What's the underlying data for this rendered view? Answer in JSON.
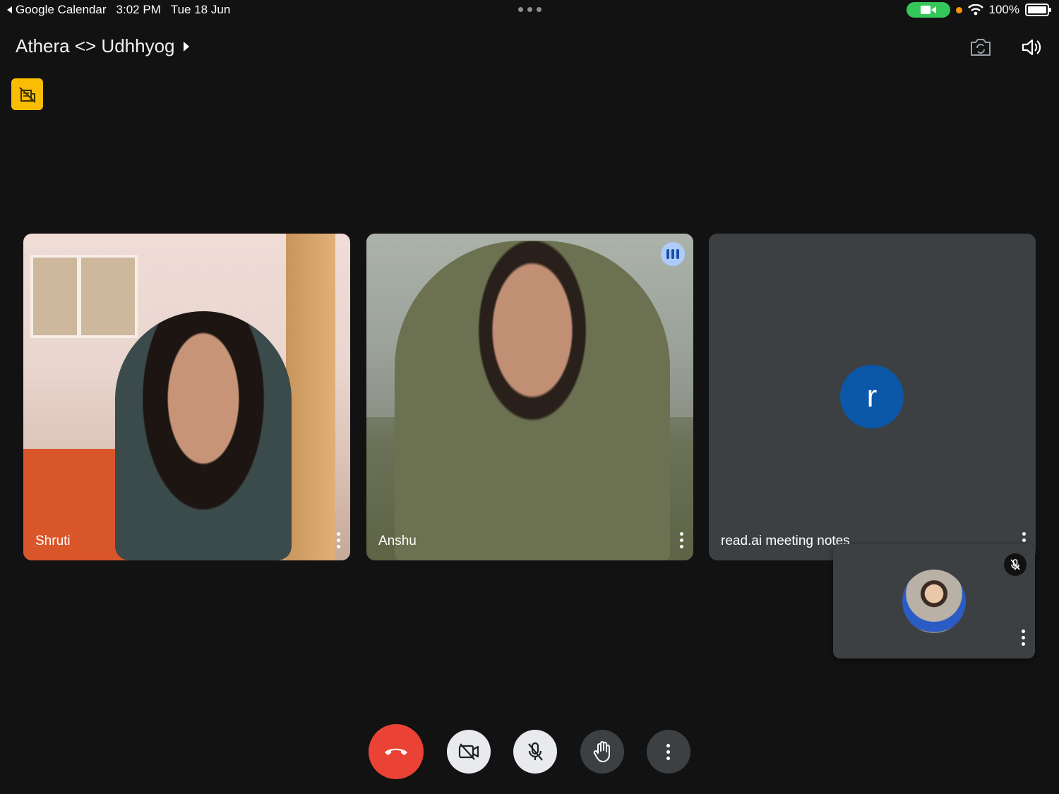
{
  "status_bar": {
    "back_app": "Google Calendar",
    "time": "3:02 PM",
    "date": "Tue 18 Jun",
    "battery": "100%"
  },
  "header": {
    "meeting_title": "Athera <> Udhhyog",
    "flip_camera_icon": "camera-flip-icon",
    "speaker_icon": "speaker-icon"
  },
  "tiles": [
    {
      "name": "Shruti",
      "type": "video"
    },
    {
      "name": "Anshu",
      "type": "video",
      "speaking": true
    },
    {
      "name": "read.ai meeting notes",
      "type": "avatar",
      "avatar_letter": "r",
      "avatar_color": "#0b57a8"
    }
  ],
  "self_view": {
    "muted": true
  },
  "controls": [
    {
      "name": "end-call-button",
      "icon": "phone-hangup-icon",
      "color": "#ea4335"
    },
    {
      "name": "camera-toggle-button",
      "icon": "camera-off-icon"
    },
    {
      "name": "mic-toggle-button",
      "icon": "mic-off-icon"
    },
    {
      "name": "raise-hand-button",
      "icon": "hand-icon"
    },
    {
      "name": "more-options-button",
      "icon": "more-vertical-icon"
    }
  ]
}
